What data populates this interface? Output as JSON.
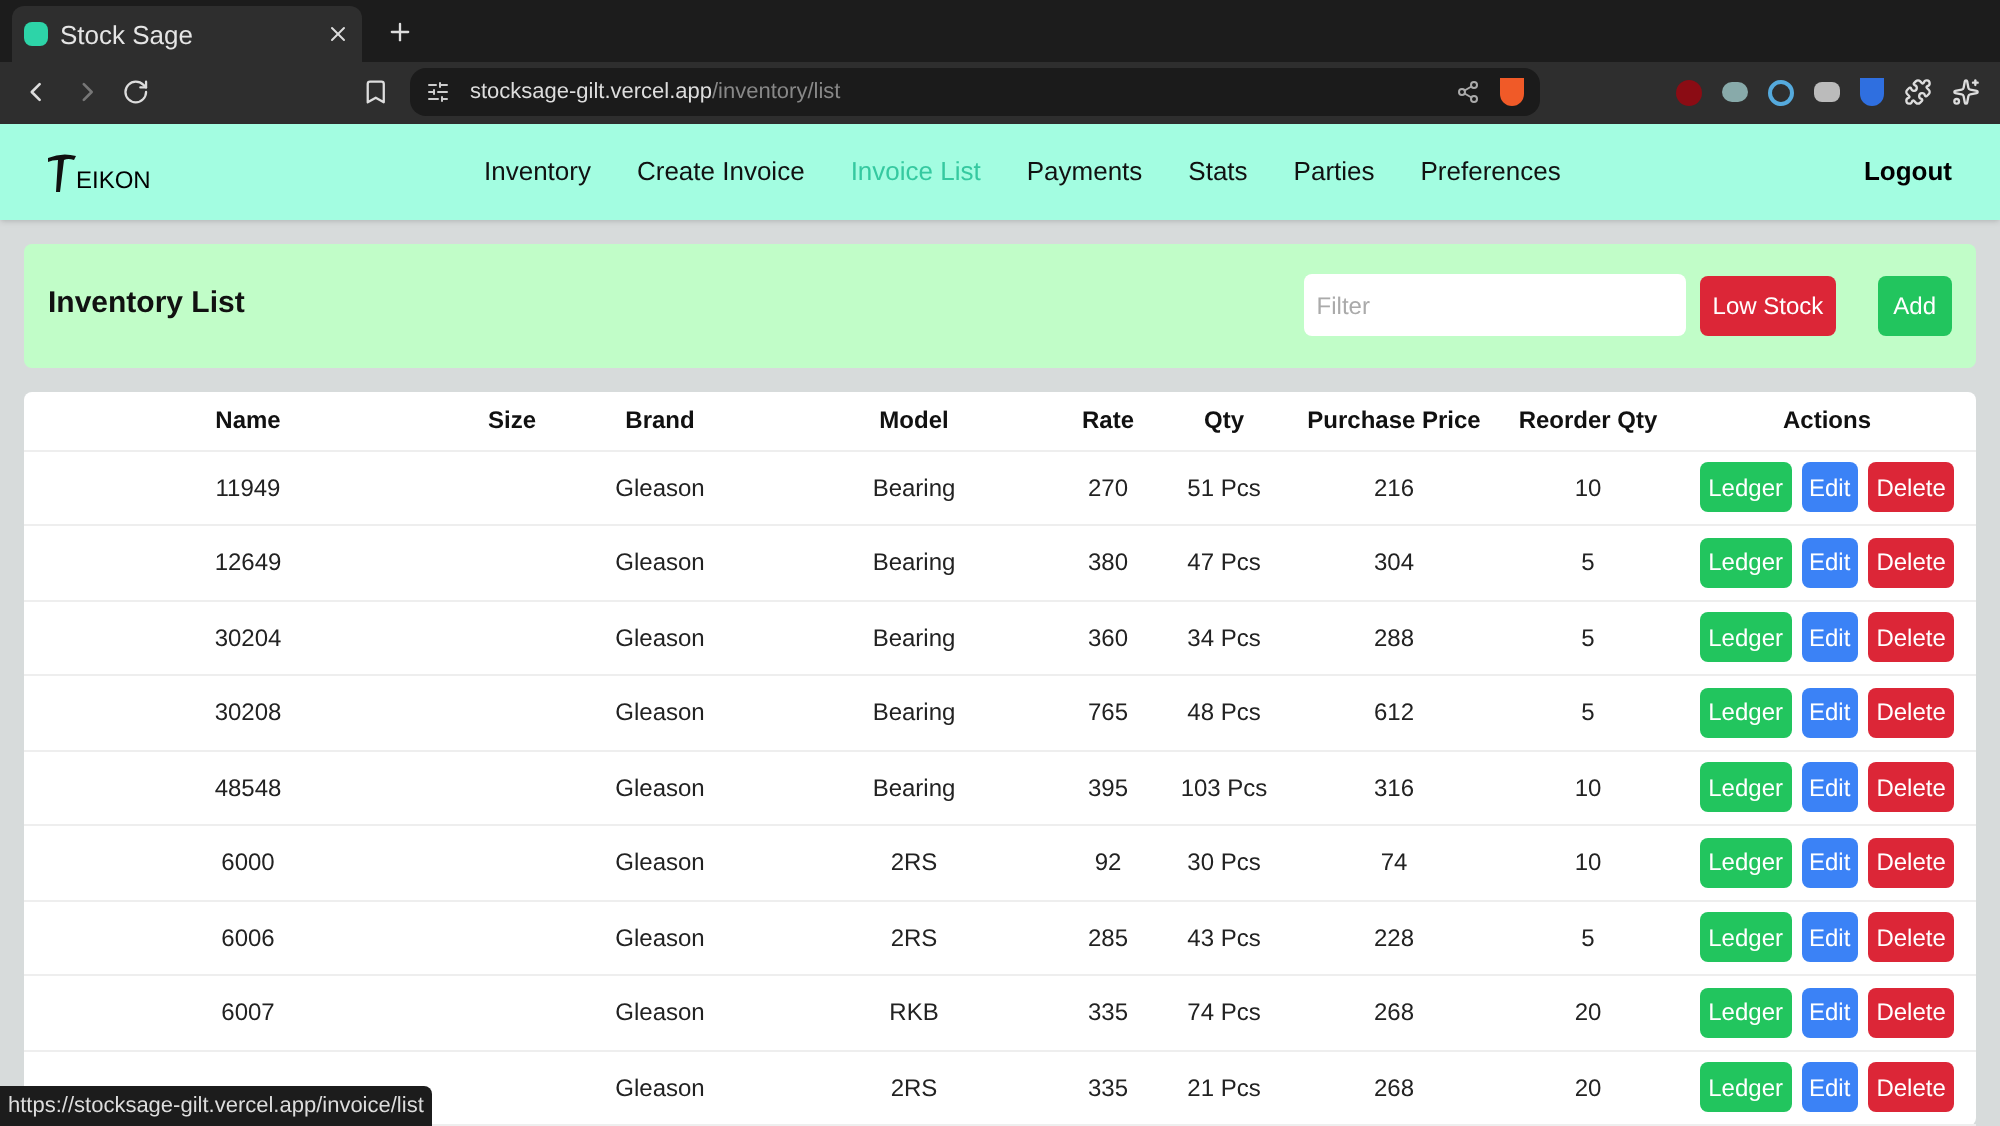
{
  "browser": {
    "tab_title": "Stock Sage",
    "url_host": "stocksage-gilt.vercel.app",
    "url_path": "/inventory/list"
  },
  "nav": {
    "logo": "EIKON",
    "items": [
      {
        "label": "Inventory",
        "hovered": false
      },
      {
        "label": "Create Invoice",
        "hovered": false
      },
      {
        "label": "Invoice List",
        "hovered": true
      },
      {
        "label": "Payments",
        "hovered": false
      },
      {
        "label": "Stats",
        "hovered": false
      },
      {
        "label": "Parties",
        "hovered": false
      },
      {
        "label": "Preferences",
        "hovered": false
      }
    ],
    "logout": "Logout"
  },
  "header": {
    "title": "Inventory List",
    "filter": {
      "placeholder": "Filter"
    },
    "low_stock": "Low Stock",
    "add": "Add"
  },
  "table": {
    "columns": [
      "Name",
      "Size",
      "Brand",
      "Model",
      "Rate",
      "Qty",
      "Purchase Price",
      "Reorder Qty",
      "Actions"
    ],
    "rows": [
      {
        "name": "11949",
        "brand": "Gleason",
        "model": "Bearing",
        "rate": "270",
        "qty": "51 Pcs",
        "purchase_price": "216",
        "reorder_qty": "10",
        "actions": [
          "Ledger",
          "Edit",
          "Delete"
        ]
      },
      {
        "name": "12649",
        "brand": "Gleason",
        "model": "Bearing",
        "rate": "380",
        "qty": "47 Pcs",
        "purchase_price": "304",
        "reorder_qty": "5",
        "actions": [
          "Ledger",
          "Edit",
          "Delete"
        ]
      },
      {
        "name": "30204",
        "brand": "Gleason",
        "model": "Bearing",
        "rate": "360",
        "qty": "34 Pcs",
        "purchase_price": "288",
        "reorder_qty": "5",
        "actions": [
          "Ledger",
          "Edit",
          "Delete"
        ]
      },
      {
        "name": "30208",
        "brand": "Gleason",
        "model": "Bearing",
        "rate": "765",
        "qty": "48 Pcs",
        "purchase_price": "612",
        "reorder_qty": "5",
        "actions": [
          "Ledger",
          "Edit",
          "Delete"
        ]
      },
      {
        "name": "48548",
        "brand": "Gleason",
        "model": "Bearing",
        "rate": "395",
        "qty": "103 Pcs",
        "purchase_price": "316",
        "reorder_qty": "10",
        "actions": [
          "Ledger",
          "Edit",
          "Delete"
        ]
      },
      {
        "name": "6000",
        "brand": "Gleason",
        "model": "2RS",
        "rate": "92",
        "qty": "30 Pcs",
        "purchase_price": "74",
        "reorder_qty": "10",
        "actions": [
          "Ledger",
          "Edit",
          "Delete"
        ]
      },
      {
        "name": "6006",
        "brand": "Gleason",
        "model": "2RS",
        "rate": "285",
        "qty": "43 Pcs",
        "purchase_price": "228",
        "reorder_qty": "5",
        "actions": [
          "Ledger",
          "Edit",
          "Delete"
        ]
      },
      {
        "name": "6007",
        "brand": "Gleason",
        "model": "RKB",
        "rate": "335",
        "qty": "74 Pcs",
        "purchase_price": "268",
        "reorder_qty": "20",
        "actions": [
          "Ledger",
          "Edit",
          "Delete"
        ]
      },
      {
        "brand": "Gleason",
        "model": "2RS",
        "rate": "335",
        "qty": "21 Pcs",
        "purchase_price": "268",
        "reorder_qty": "20",
        "actions": [
          "Ledger",
          "Edit",
          "Delete"
        ]
      }
    ]
  },
  "status_bar": {
    "url": "https://stocksage-gilt.vercel.app/invoice/list"
  }
}
